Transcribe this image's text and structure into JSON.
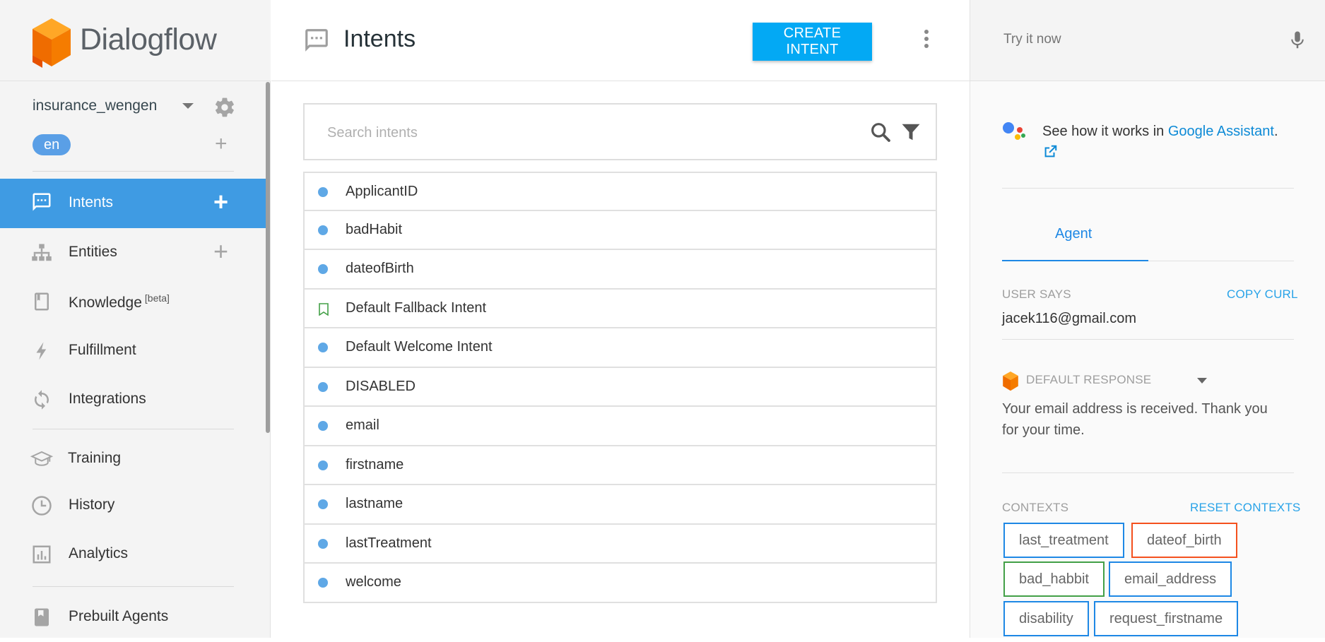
{
  "logo": {
    "text": "Dialogflow"
  },
  "agent": {
    "name": "insurance_wengen",
    "language": "en"
  },
  "sidebar": {
    "items": [
      {
        "label": "Intents",
        "active": true,
        "has_add": true
      },
      {
        "label": "Entities",
        "active": false,
        "has_add": true
      },
      {
        "label": "Knowledge",
        "badge": "[beta]"
      },
      {
        "label": "Fulfillment"
      },
      {
        "label": "Integrations"
      },
      {
        "label": "Training"
      },
      {
        "label": "History"
      },
      {
        "label": "Analytics"
      },
      {
        "label": "Prebuilt Agents"
      }
    ]
  },
  "header": {
    "title": "Intents",
    "create_label": "CREATE INTENT"
  },
  "search": {
    "placeholder": "Search intents"
  },
  "intents": [
    {
      "name": "ApplicantID",
      "type": "dot"
    },
    {
      "name": "badHabit",
      "type": "dot"
    },
    {
      "name": "dateofBirth",
      "type": "dot"
    },
    {
      "name": "Default Fallback Intent",
      "type": "bookmark"
    },
    {
      "name": "Default Welcome Intent",
      "type": "dot"
    },
    {
      "name": "DISABLED",
      "type": "dot"
    },
    {
      "name": "email",
      "type": "dot"
    },
    {
      "name": "firstname",
      "type": "dot"
    },
    {
      "name": "lastname",
      "type": "dot"
    },
    {
      "name": "lastTreatment",
      "type": "dot"
    },
    {
      "name": "welcome",
      "type": "dot"
    }
  ],
  "right": {
    "try_placeholder": "Try it now",
    "ga_text": "See how it works in ",
    "ga_link": "Google Assistant",
    "ga_period": ".",
    "tab_agent": "Agent",
    "user_says_label": "USER SAYS",
    "copy_curl": "COPY CURL",
    "user_says_value": "jacek116@gmail.com",
    "default_response_label": "DEFAULT RESPONSE",
    "response_text": "Your email address is received. Thank you for your time.",
    "contexts_label": "CONTEXTS",
    "reset_contexts": "RESET CONTEXTS",
    "contexts": [
      {
        "name": "last_treatment",
        "color": "#1e88e5"
      },
      {
        "name": "dateof_birth",
        "color": "#f4511e"
      },
      {
        "name": "bad_habbit",
        "color": "#43a047"
      },
      {
        "name": "email_address",
        "color": "#1e88e5"
      },
      {
        "name": "disability",
        "color": "#1e88e5"
      },
      {
        "name": "request_firstname",
        "color": "#1e88e5"
      }
    ]
  },
  "colors": {
    "accent": "#03a9f4",
    "active_nav": "#3f9be3",
    "intent_dot": "#5fa8e6"
  }
}
